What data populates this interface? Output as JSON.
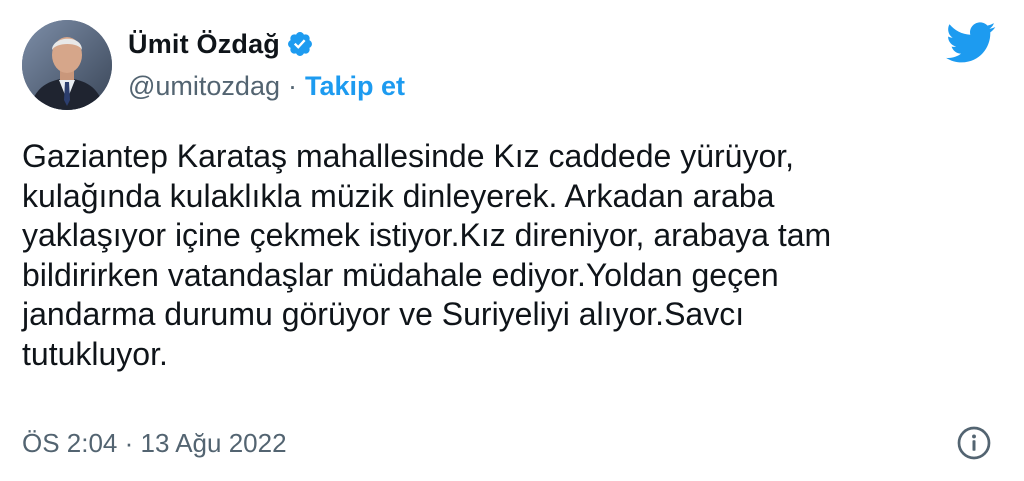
{
  "author": {
    "display_name": "Ümit Özdağ",
    "handle": "@umitozdag",
    "separator": "·",
    "follow_label": "Takip et",
    "verified": true
  },
  "tweet": {
    "text": "Gaziantep Karataş mahallesinde Kız caddede yürüyor,\nkulağında kulaklıkla müzik dinleyerek. Arkadan araba\nyaklaşıyor içine çekmek istiyor.Kız direniyor, arabaya tam\nbildirirken vatandaşlar müdahale ediyor.Yoldan geçen\njandarma durumu görüyor ve Suriyeliyi alıyor.Savcı\ntutukluyor.",
    "timestamp": "ÖS 2:04 · 13 Ağu 2022"
  },
  "icons": {
    "verified": "verified-badge-icon",
    "brand": "twitter-bird-icon",
    "info": "info-icon"
  },
  "colors": {
    "accent": "#1d9bf0",
    "text_primary": "#0f1419",
    "text_secondary": "#536471",
    "background": "#ffffff"
  }
}
